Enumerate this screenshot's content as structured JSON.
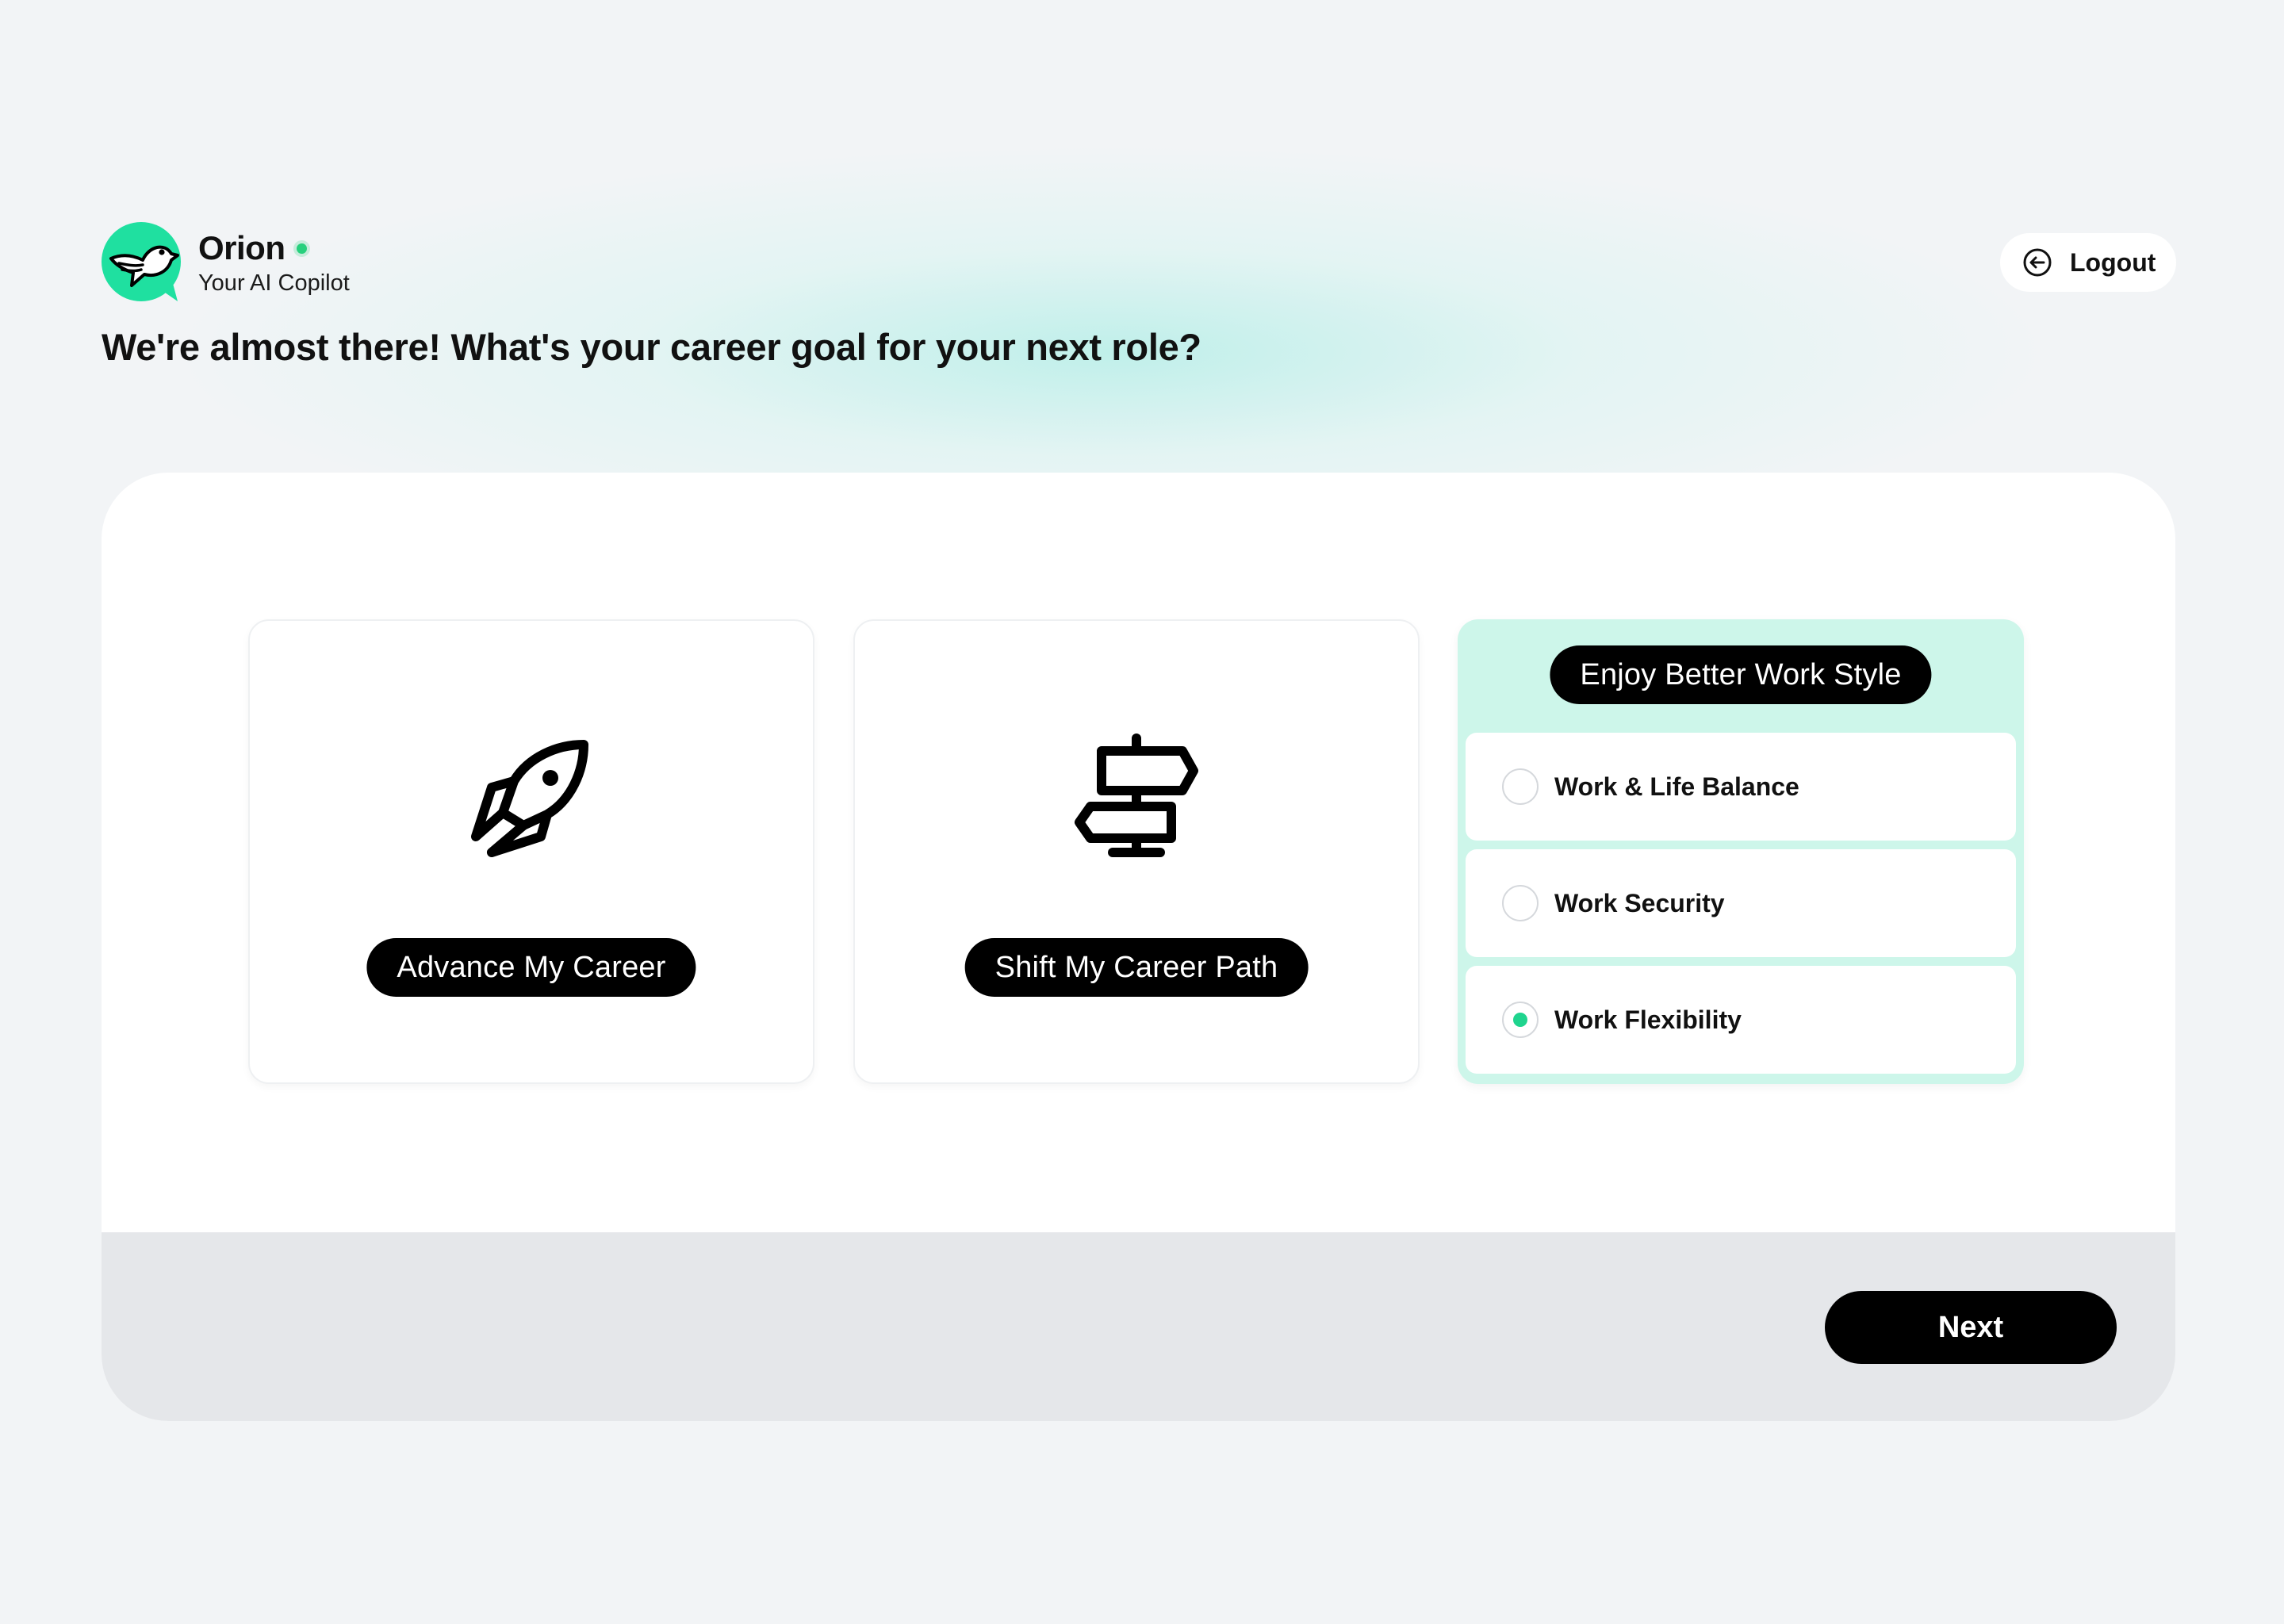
{
  "brand": {
    "name": "Orion",
    "subtitle": "Your AI Copilot",
    "status": "online",
    "accent_color": "#1fe0a0"
  },
  "logout": {
    "label": "Logout",
    "icon": "logout-arrow-icon"
  },
  "question": "We're almost there! What's your career goal for your next role?",
  "goals": [
    {
      "label": "Advance My Career",
      "icon": "rocket-icon",
      "selected": false
    },
    {
      "label": "Shift My Career Path",
      "icon": "signpost-icon",
      "selected": false
    },
    {
      "label": "Enjoy Better Work Style",
      "selected": true,
      "options": [
        {
          "label": "Work & Life Balance",
          "checked": false
        },
        {
          "label": "Work Security",
          "checked": false
        },
        {
          "label": "Work Flexibility",
          "checked": true
        }
      ]
    }
  ],
  "footer": {
    "next_label": "Next"
  },
  "colors": {
    "selected_card_bg": "#cdf6ea",
    "radio_checked": "#1fd48e",
    "button_bg": "#000000"
  }
}
